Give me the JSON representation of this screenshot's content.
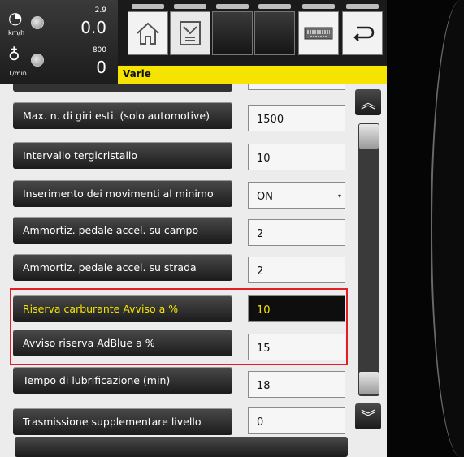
{
  "gauges": {
    "speed": {
      "small": "2.9",
      "value": "0.0",
      "unit": "km/h"
    },
    "rpm": {
      "small": "800",
      "value": "0",
      "unit": "1/min"
    }
  },
  "toolbar": {
    "buttons": [
      "home-icon",
      "menu-icon",
      "empty",
      "empty",
      "keyboard-icon",
      "back-icon"
    ]
  },
  "title": "Varie",
  "rows": [
    {
      "label": "Max. n. di giri esti. (solo automotive)",
      "value": "1500"
    },
    {
      "label": "Intervallo tergicristallo",
      "value": "10"
    },
    {
      "label": "Inserimento dei movimenti al minimo",
      "value": "ON"
    },
    {
      "label": "Ammortiz. pedale accel. su campo",
      "value": "2"
    },
    {
      "label": "Ammortiz. pedale accel. su strada",
      "value": "2"
    },
    {
      "label": "Riserva carburante Avviso a %",
      "value": "10"
    },
    {
      "label": "Avviso riserva AdBlue a %",
      "value": "15"
    },
    {
      "label": "Tempo di lubrificazione (min)",
      "value": "18"
    },
    {
      "label": "Trasmissione supplementare livello",
      "value": "0"
    }
  ],
  "colors": {
    "title_bar": "#f5e400",
    "highlight": "#e31e24",
    "selected_text": "#f5e400"
  }
}
